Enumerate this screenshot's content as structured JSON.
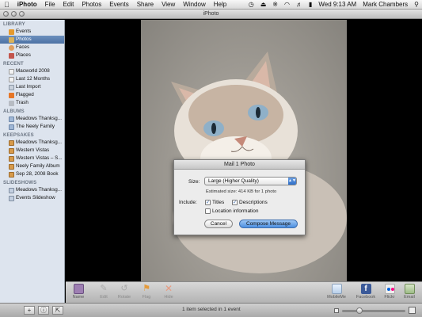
{
  "menubar": {
    "apple": "",
    "app": "iPhoto",
    "items": [
      "File",
      "Edit",
      "Photos",
      "Events",
      "Share",
      "View",
      "Window",
      "Help"
    ],
    "clock": "Wed 9:13 AM",
    "user": "Mark Chambers",
    "icons": [
      "time-machine-icon",
      "eject-icon",
      "bluetooth-icon",
      "wifi-icon",
      "volume-icon",
      "battery-icon",
      "spotlight-icon"
    ]
  },
  "window": {
    "title": "iPhoto"
  },
  "sidebar": {
    "library_header": "LIBRARY",
    "library": [
      {
        "label": "Events",
        "icon": "events-icon"
      },
      {
        "label": "Photos",
        "icon": "photos-icon",
        "selected": true
      },
      {
        "label": "Faces",
        "icon": "faces-icon"
      },
      {
        "label": "Places",
        "icon": "places-icon"
      }
    ],
    "recent_header": "RECENT",
    "recent": [
      {
        "label": "Macworld 2008",
        "icon": "calendar-icon"
      },
      {
        "label": "Last 12 Months",
        "icon": "calendar-icon"
      },
      {
        "label": "Last Import",
        "icon": "import-icon"
      },
      {
        "label": "Flagged",
        "icon": "flag-icon"
      },
      {
        "label": "Trash",
        "icon": "trash-icon"
      }
    ],
    "albums_header": "ALBUMS",
    "albums": [
      {
        "label": "Meadows Thanksg...",
        "icon": "album-icon"
      },
      {
        "label": "The Neely Family",
        "icon": "album-icon"
      }
    ],
    "keepsakes_header": "KEEPSAKES",
    "keepsakes": [
      {
        "label": "Meadows Thanksg...",
        "icon": "keepsake-icon"
      },
      {
        "label": "Western Vistas",
        "icon": "keepsake-icon"
      },
      {
        "label": "Western Vistas – S...",
        "icon": "keepsake-icon"
      },
      {
        "label": "Neely Family Album",
        "icon": "keepsake-icon"
      },
      {
        "label": "Sep 28, 2008 Book",
        "icon": "keepsake-icon"
      }
    ],
    "slideshows_header": "SLIDESHOWS",
    "slideshows": [
      {
        "label": "Meadows Thanksg...",
        "icon": "slideshow-icon"
      },
      {
        "label": "Events Slideshow",
        "icon": "slideshow-icon"
      }
    ]
  },
  "dialog": {
    "title": "Mail 1 Photo",
    "size_label": "Size:",
    "size_value": "Large (Higher Quality)",
    "estimate": "Estimated size: 414 KB for 1 photo",
    "include_label": "Include:",
    "titles_label": "Titles",
    "titles_checked": true,
    "descriptions_label": "Descriptions",
    "descriptions_checked": true,
    "location_label": "Location information",
    "location_checked": false,
    "cancel_label": "Cancel",
    "compose_label": "Compose Message"
  },
  "toolbar": {
    "name": "Name",
    "edit": "Edit",
    "rotate": "Rotate",
    "flag": "Flag",
    "hide": "Hide",
    "mobileme": "MobileMe",
    "facebook": "Facebook",
    "flickr": "Flickr",
    "email": "Email"
  },
  "status": {
    "text": "1 item selected in 1 event",
    "zoom_level": 0.25
  },
  "colors": {
    "selection": "#4c71a4",
    "sidebar_bg": "#dde4ee",
    "default_button": "#4c8fe0"
  }
}
